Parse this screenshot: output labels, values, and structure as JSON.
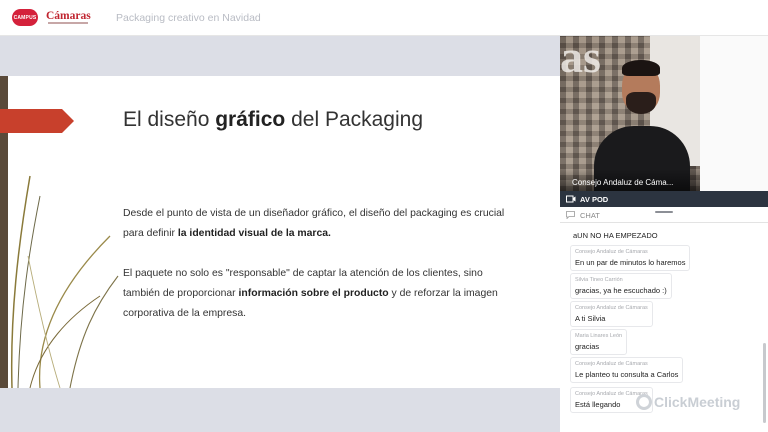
{
  "header": {
    "logo_left_text": "CAMPUS",
    "logo_camaras_text": "Cámaras",
    "title": "Packaging creativo en Navidad"
  },
  "slide": {
    "heading_pre": "El diseño ",
    "heading_bold": "gráfico",
    "heading_post": " del Packaging",
    "p1_text": "Desde el punto de vista de un diseñador gráfico, el diseño del packaging es crucial para definir ",
    "p1_bold": "la identidad visual de la marca.",
    "p2_text": "El paquete no solo es \"responsable\" de captar la atención de los clientes, sino también de proporcionar ",
    "p2_bold": "información sobre el producto",
    "p2_text_end": " y de reforzar la imagen corporativa de la empresa.",
    "colors": {
      "arrow": "#c8402c",
      "leftbar": "#5a4a3a",
      "deco": "#8a7a3a"
    }
  },
  "video": {
    "name_label": "Consejo Andaluz de Cáma...",
    "backdrop_text": "as"
  },
  "avpod": {
    "label": "AV POD",
    "icon": "camera-icon"
  },
  "chat": {
    "header_label": "CHAT",
    "icon": "chat-icon",
    "plain_message": "aUN NO HA EMPEZADO",
    "messages": [
      {
        "author": "Consejo Andaluz de Cámaras",
        "text": "En un par de minutos lo haremos"
      },
      {
        "author": "Silvia Tineo Carrión",
        "text": "gracias, ya he escuchado :)"
      },
      {
        "author": "Consejo Andaluz de Cámaras",
        "text": "A ti Silvia"
      },
      {
        "author": "Maria Linares León",
        "text": "gracias"
      },
      {
        "author": "Consejo Andaluz de Cámaras",
        "text": "Le planteo tu consulta a Carlos"
      },
      {
        "author": "Consejo Andaluz de Cámaras",
        "text": "Está llegando"
      }
    ]
  },
  "watermark": {
    "text": "ClickMeeting"
  }
}
